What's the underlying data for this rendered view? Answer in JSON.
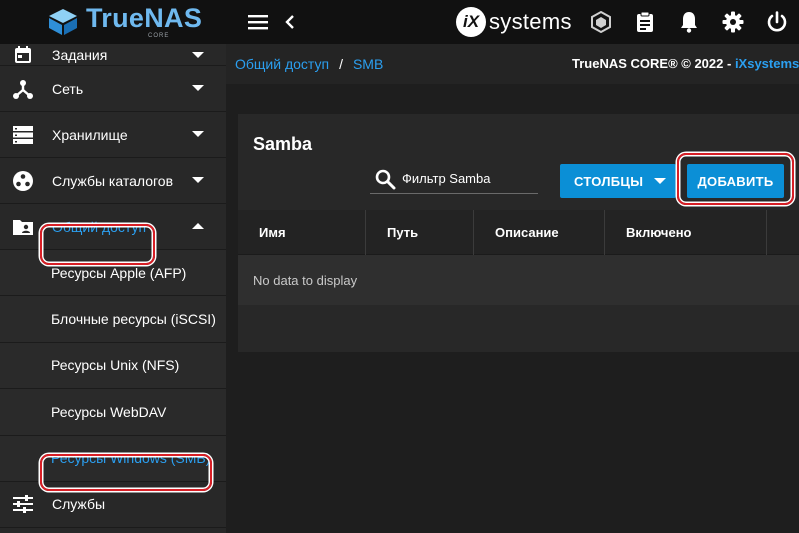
{
  "brand": {
    "name": "TrueNAS",
    "sub": "CORE"
  },
  "topbar": {
    "vendor_logo_mark": "iX",
    "vendor_logo_text": "systems"
  },
  "sidebar": {
    "items": [
      {
        "label": "Задания",
        "icon": "calendar-icon"
      },
      {
        "label": "Сеть",
        "icon": "network-icon"
      },
      {
        "label": "Хранилище",
        "icon": "storage-icon"
      },
      {
        "label": "Службы каталогов",
        "icon": "directory-icon"
      },
      {
        "label": "Общий доступ",
        "icon": "folder-shared-icon"
      }
    ],
    "sub_items": [
      {
        "label": "Ресурсы Apple (AFP)"
      },
      {
        "label": "Блочные ресурсы (iSCSI)"
      },
      {
        "label": "Ресурсы Unix (NFS)"
      },
      {
        "label": "Ресурсы WebDAV"
      },
      {
        "label": "Ресурсы Windows (SMB)"
      }
    ],
    "last_item": {
      "label": "Службы",
      "icon": "tune-icon"
    }
  },
  "breadcrumb": {
    "parent": "Общий доступ",
    "separator": "/",
    "current": "SMB"
  },
  "copyright": {
    "text": "TrueNAS CORE® © 2022 - ",
    "link": "iXsystems, Inc"
  },
  "card": {
    "title": "Samba",
    "filter_placeholder": "Фильтр Samba",
    "columns_button": "СТОЛБЦЫ",
    "add_button": "ДОБАВИТЬ",
    "columns": [
      "Имя",
      "Путь",
      "Описание",
      "Включено"
    ],
    "empty_text": "No data to display"
  },
  "colors": {
    "accent": "#0b8fd6",
    "link": "#2b9ff0",
    "highlight": "#d81f26",
    "brand": "#6fb9ef"
  }
}
